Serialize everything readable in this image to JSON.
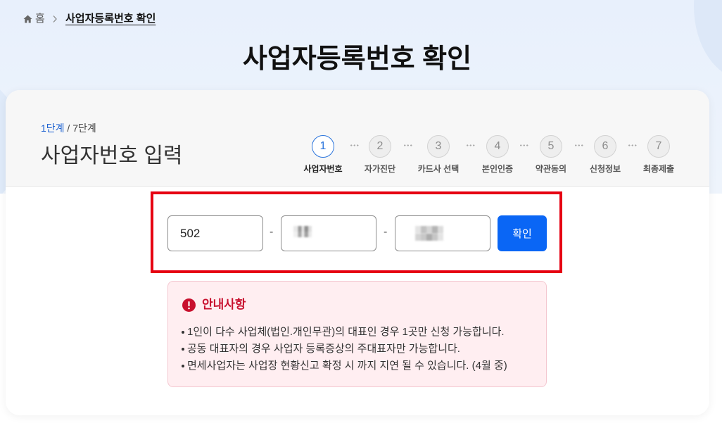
{
  "breadcrumb": {
    "home_icon": "home-icon",
    "home_label": "홈",
    "separator_icon": "chevron-right-icon",
    "current": "사업자등록번호 확인"
  },
  "page_title": "사업자등록번호 확인",
  "step_indicator": {
    "current": "1단계",
    "rest": " / 7단계"
  },
  "section_title": "사업자번호 입력",
  "steps": [
    {
      "number": "1",
      "label": "사업자번호",
      "active": true
    },
    {
      "number": "2",
      "label": "자가진단",
      "active": false
    },
    {
      "number": "3",
      "label": "카드사 선택",
      "active": false
    },
    {
      "number": "4",
      "label": "본인인증",
      "active": false
    },
    {
      "number": "5",
      "label": "약관동의",
      "active": false
    },
    {
      "number": "6",
      "label": "신청정보",
      "active": false
    },
    {
      "number": "7",
      "label": "최종제출",
      "active": false
    }
  ],
  "form": {
    "field1_value": "502",
    "separator": "-",
    "submit_label": "확인"
  },
  "notice": {
    "icon": "exclamation-circle-icon",
    "title": "안내사항",
    "items": [
      "1인이 다수 사업체(법인.개인무관)의 대표인 경우 1곳만 신청 가능합니다.",
      "공동 대표자의 경우 사업자 등록증상의 주대표자만 가능합니다.",
      "면세사업자는 사업장 현황신고 확정 시 까지 지연 될 수 있습니다. (4월 중)"
    ]
  },
  "colors": {
    "primary": "#0a66f5",
    "active_step": "#2a74dc",
    "notice_accent": "#c8102e",
    "notice_bg": "#ffeef1",
    "highlight": "#e60012"
  }
}
